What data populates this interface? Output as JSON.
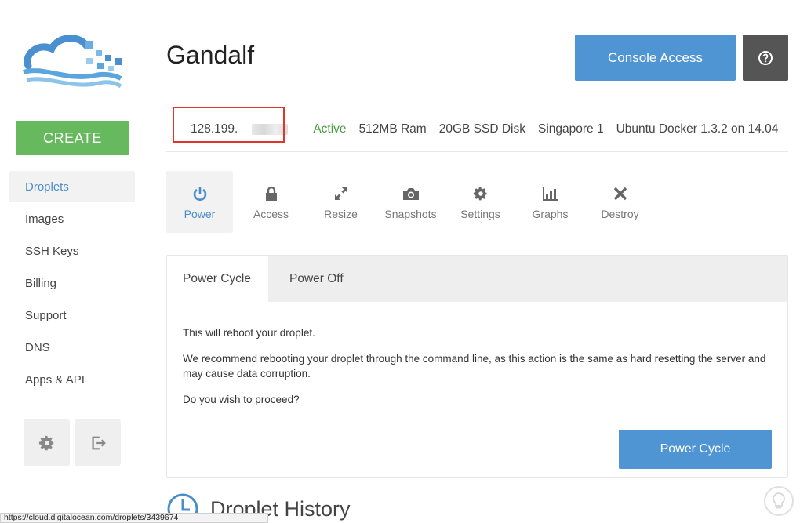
{
  "sidebar": {
    "create_label": "CREATE",
    "items": [
      {
        "label": "Droplets",
        "active": true
      },
      {
        "label": "Images"
      },
      {
        "label": "SSH Keys"
      },
      {
        "label": "Billing"
      },
      {
        "label": "Support"
      },
      {
        "label": "DNS"
      },
      {
        "label": "Apps & API"
      }
    ],
    "bottom_icons": [
      "gear-icon",
      "logout-icon"
    ]
  },
  "header": {
    "title": "Gandalf",
    "console_label": "Console Access",
    "help_icon": "question-circle-icon"
  },
  "info": {
    "ip": "128.199.",
    "status": "Active",
    "ram": "512MB Ram",
    "disk": "20GB SSD Disk",
    "region": "Singapore 1",
    "image": "Ubuntu Docker 1.3.2 on 14.04"
  },
  "actions": [
    {
      "label": "Power",
      "icon": "power-icon",
      "active": true
    },
    {
      "label": "Access",
      "icon": "lock-icon"
    },
    {
      "label": "Resize",
      "icon": "resize-arrows-icon"
    },
    {
      "label": "Snapshots",
      "icon": "camera-icon"
    },
    {
      "label": "Settings",
      "icon": "gear-icon"
    },
    {
      "label": "Graphs",
      "icon": "bar-chart-icon"
    },
    {
      "label": "Destroy",
      "icon": "x-icon"
    }
  ],
  "panel": {
    "tabs": [
      {
        "label": "Power Cycle",
        "active": true
      },
      {
        "label": "Power Off"
      }
    ],
    "p1": "This will reboot your droplet.",
    "p2": "We recommend rebooting your droplet through the command line, as this action is the same as hard resetting the server and may cause data corruption.",
    "p3": "Do you wish to proceed?",
    "button_label": "Power Cycle"
  },
  "history": {
    "title": "Droplet History"
  },
  "status_bar": {
    "url": "https://cloud.digitalocean.com/droplets/3439674"
  },
  "colors": {
    "accent": "#4f95d3",
    "create": "#67b95e",
    "active_status": "#4a9a3f",
    "highlight_box": "#e0352b"
  }
}
